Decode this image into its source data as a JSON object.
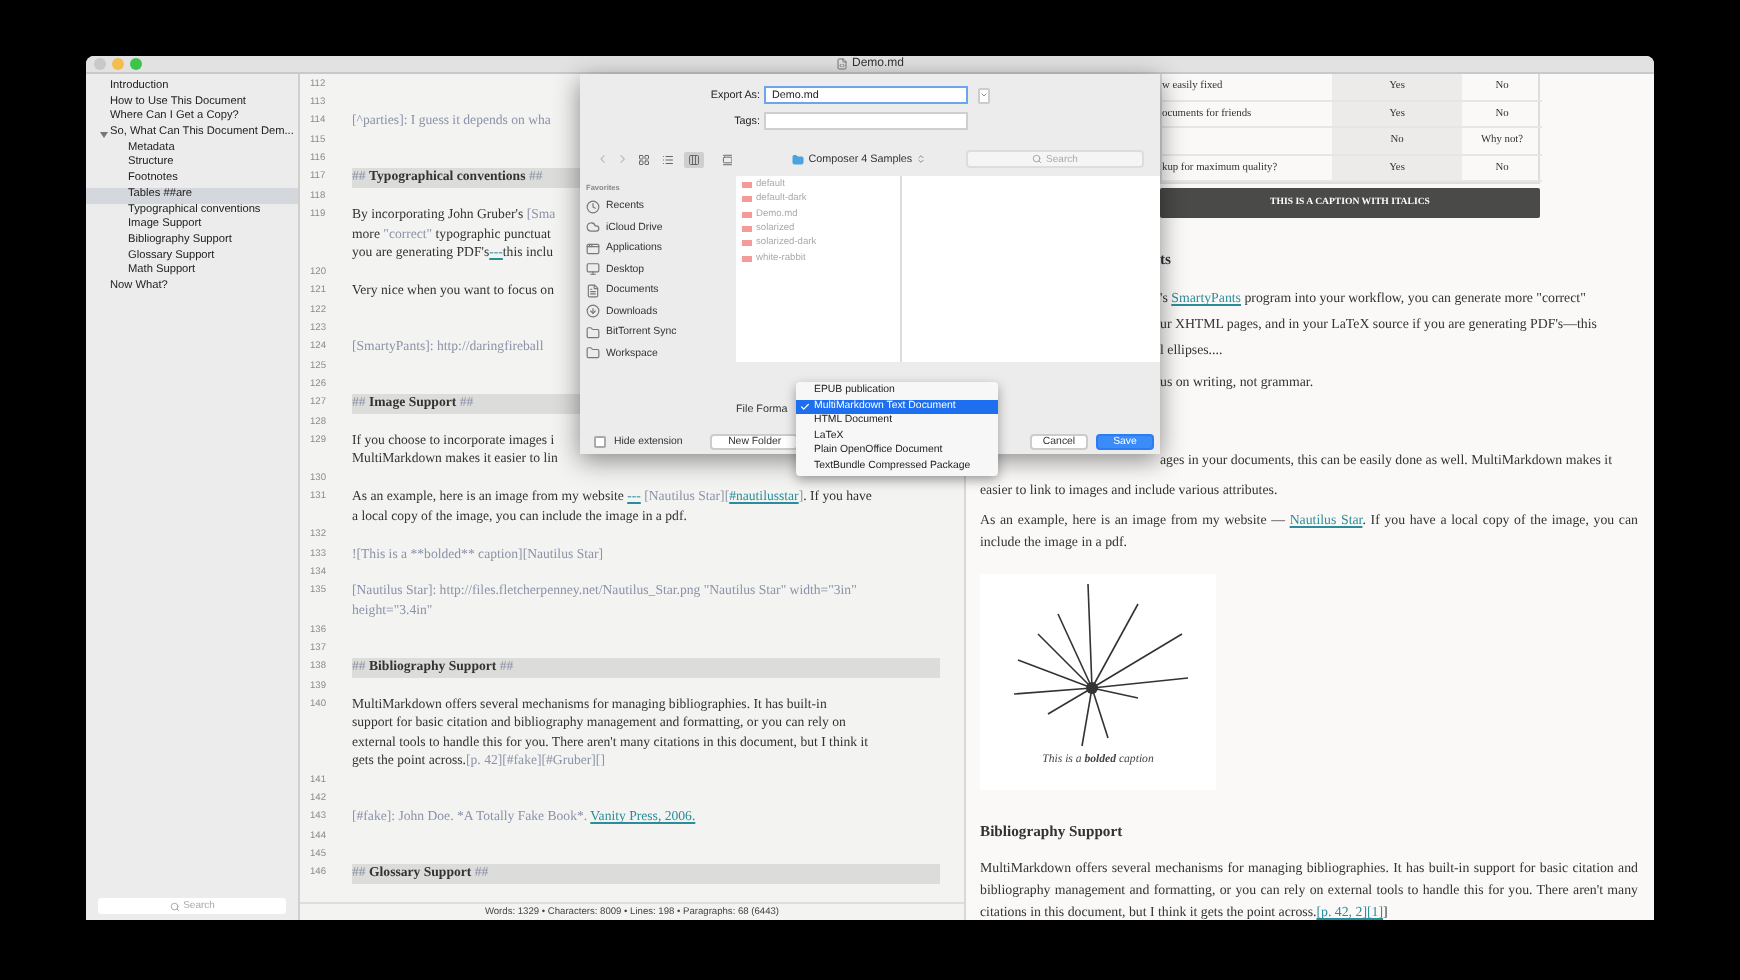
{
  "window": {
    "title": "Demo.md"
  },
  "sidebar": {
    "items": [
      {
        "label": "Introduction",
        "selected": false
      },
      {
        "label": "How to Use This Document",
        "selected": false
      },
      {
        "label": "Where Can I Get a Copy?",
        "selected": false
      },
      {
        "label": "So, What Can This Document Dem...",
        "selected": false,
        "expanded": true,
        "children": [
          {
            "label": "Metadata",
            "selected": false
          },
          {
            "label": "Structure",
            "selected": false
          },
          {
            "label": "Footnotes",
            "selected": false
          },
          {
            "label": "Tables ##are",
            "selected": true
          },
          {
            "label": "Typographical conventions",
            "selected": false
          },
          {
            "label": "Image Support",
            "selected": false
          },
          {
            "label": "Bibliography Support",
            "selected": false
          },
          {
            "label": "Glossary Support",
            "selected": false
          },
          {
            "label": "Math Support",
            "selected": false
          }
        ]
      },
      {
        "label": "Now What?",
        "selected": false
      }
    ],
    "search": {
      "placeholder": "Search"
    }
  },
  "editor": {
    "lines": [
      {
        "number": "112",
        "kind": "blank"
      },
      {
        "number": "113",
        "kind": "blank"
      },
      {
        "number": "114",
        "kind": "text",
        "rows": [
          {
            "segments": [
              {
                "t": "[^parties]: I guess it depends on wha",
                "kind": "muted"
              }
            ]
          }
        ]
      },
      {
        "number": "115",
        "kind": "blank"
      },
      {
        "number": "116",
        "kind": "blank"
      },
      {
        "number": "117",
        "kind": "heading",
        "rows": [
          {
            "segments": [
              {
                "t": "## ",
                "kind": "muted"
              },
              {
                "t": "Typographical conventions",
                "kind": "bold"
              },
              {
                "t": " ##",
                "kind": "muted"
              }
            ]
          }
        ]
      },
      {
        "number": "118",
        "kind": "blank"
      },
      {
        "number": "119",
        "kind": "text",
        "rows": [
          {
            "segments": [
              {
                "t": "By incorporating John Gruber's "
              },
              {
                "t": "[Sma",
                "kind": "muted"
              }
            ]
          },
          {
            "segments": [
              {
                "t": "more "
              },
              {
                "t": "\"correct\"",
                "kind": "muted"
              },
              {
                "t": " typographic punctuat"
              }
            ]
          },
          {
            "segments": [
              {
                "t": "you are generating PDF's"
              },
              {
                "t": "---",
                "kind": "link"
              },
              {
                "t": "this inclu"
              }
            ]
          }
        ]
      },
      {
        "number": "120",
        "kind": "blank"
      },
      {
        "number": "121",
        "kind": "text",
        "rows": [
          {
            "segments": [
              {
                "t": "Very nice when you want to focus on"
              }
            ]
          }
        ]
      },
      {
        "number": "122",
        "kind": "blank"
      },
      {
        "number": "123",
        "kind": "blank"
      },
      {
        "number": "124",
        "kind": "text",
        "rows": [
          {
            "segments": [
              {
                "t": "[SmartyPants]: http://daringfireball",
                "kind": "muted"
              }
            ]
          }
        ]
      },
      {
        "number": "125",
        "kind": "blank"
      },
      {
        "number": "126",
        "kind": "blank"
      },
      {
        "number": "127",
        "kind": "heading",
        "rows": [
          {
            "segments": [
              {
                "t": "## ",
                "kind": "muted"
              },
              {
                "t": "Image Support",
                "kind": "bold"
              },
              {
                "t": " ##",
                "kind": "muted"
              }
            ]
          }
        ]
      },
      {
        "number": "128",
        "kind": "blank"
      },
      {
        "number": "129",
        "kind": "text",
        "rows": [
          {
            "segments": [
              {
                "t": "If you choose to incorporate images i"
              }
            ]
          },
          {
            "segments": [
              {
                "t": "MultiMarkdown makes it easier to lin"
              }
            ]
          }
        ]
      },
      {
        "number": "130",
        "kind": "blank"
      },
      {
        "number": "131",
        "kind": "text",
        "rows": [
          {
            "segments": [
              {
                "t": "As an example, here is an image from my website "
              },
              {
                "t": "---",
                "kind": "link"
              },
              {
                "t": " [Nautilus Star][",
                "kind": "muted"
              },
              {
                "t": "#nautilusstar",
                "kind": "link"
              },
              {
                "t": "]",
                "kind": "muted"
              },
              {
                "t": ". If you have"
              }
            ]
          },
          {
            "segments": [
              {
                "t": "a local copy of the image, you can include the image in a pdf."
              }
            ]
          }
        ]
      },
      {
        "number": "132",
        "kind": "blank"
      },
      {
        "number": "133",
        "kind": "text",
        "rows": [
          {
            "segments": [
              {
                "t": "![This is a **bolded** caption][Nautilus Star]",
                "kind": "muted"
              }
            ]
          }
        ]
      },
      {
        "number": "134",
        "kind": "blank"
      },
      {
        "number": "135",
        "kind": "text",
        "rows": [
          {
            "segments": [
              {
                "t": "[Nautilus Star]: http://files.fletcherpenney.net/Nautilus_Star.png \"Nautilus Star\" width=\"3in\"",
                "kind": "muted"
              }
            ]
          },
          {
            "segments": [
              {
                "t": "height=\"3.4in\"",
                "kind": "muted"
              }
            ]
          }
        ]
      },
      {
        "number": "136",
        "kind": "blank"
      },
      {
        "number": "137",
        "kind": "blank"
      },
      {
        "number": "138",
        "kind": "heading",
        "rows": [
          {
            "segments": [
              {
                "t": "## ",
                "kind": "muted"
              },
              {
                "t": "Bibliography Support",
                "kind": "bold"
              },
              {
                "t": " ##",
                "kind": "muted"
              }
            ]
          }
        ]
      },
      {
        "number": "139",
        "kind": "blank"
      },
      {
        "number": "140",
        "kind": "text",
        "rows": [
          {
            "segments": [
              {
                "t": "MultiMarkdown offers several mechanisms for managing bibliographies.  It has built-in"
              }
            ]
          },
          {
            "segments": [
              {
                "t": "support for basic citation and bibliography management and formatting, or you can rely on"
              }
            ]
          },
          {
            "segments": [
              {
                "t": "external tools to handle this for you. There aren't many citations in this document, but I think it"
              }
            ]
          },
          {
            "segments": [
              {
                "t": "gets the point across."
              },
              {
                "t": "[p. 42][#fake][#Gruber][]",
                "kind": "muted"
              }
            ]
          }
        ]
      },
      {
        "number": "141",
        "kind": "blank"
      },
      {
        "number": "142",
        "kind": "blank"
      },
      {
        "number": "143",
        "kind": "text",
        "rows": [
          {
            "segments": [
              {
                "t": "[#fake]: John Doe. *A Totally Fake Book*. ",
                "kind": "muted"
              },
              {
                "t": "Vanity Press, 2006.",
                "kind": "link"
              }
            ]
          }
        ]
      },
      {
        "number": "144",
        "kind": "blank"
      },
      {
        "number": "145",
        "kind": "blank"
      },
      {
        "number": "146",
        "kind": "heading",
        "rows": [
          {
            "segments": [
              {
                "t": "## ",
                "kind": "muted"
              },
              {
                "t": "Glossary Support",
                "kind": "bold"
              },
              {
                "t": " ##",
                "kind": "muted"
              }
            ]
          }
        ]
      }
    ]
  },
  "status_bar": "Words: 1329 • Characters: 8009 • Lines: 198 • Paragraphs: 68 (6443)",
  "preview": {
    "table": {
      "rows": [
        [
          "w easily fixed",
          "Yes",
          "No"
        ],
        [
          "ocuments for friends",
          "Yes",
          "No"
        ],
        [
          "",
          "No",
          "Why not?"
        ],
        [
          "kup for maximum quality?",
          "Yes",
          "No"
        ]
      ]
    },
    "caption": "THIS IS A CAPTION WITH ITALICS",
    "partial_blocks": [
      {
        "kind": "heading",
        "segments": [
          {
            "t": "ts"
          }
        ]
      },
      {
        "kind": "line",
        "segments": [
          {
            "t": "'s "
          },
          {
            "t": "SmartyPants",
            "kind": "link"
          },
          {
            "t": " program into your workflow, you can generate more \"correct\""
          }
        ]
      },
      {
        "kind": "line",
        "segments": [
          {
            "t": "ur XHTML pages, and in your LaTeX source if you are generating PDF's—this"
          }
        ]
      },
      {
        "kind": "line",
        "segments": [
          {
            "t": "l ellipses...."
          }
        ]
      },
      {
        "kind": "paragraph",
        "segments": [
          {
            "t": "us on writing, not grammar."
          }
        ]
      },
      {
        "kind": "gap"
      },
      {
        "kind": "paragraph",
        "segments": [
          {
            "t": "ages in your documents, this can be easily done as well. MultiMarkdown makes it"
          }
        ]
      }
    ],
    "blocks": [
      {
        "kind": "paragraph",
        "segments": [
          {
            "t": "easier to link to images and include various attributes."
          }
        ]
      },
      {
        "kind": "paragraph",
        "segments": [
          {
            "t": "As an example, here is an image from my website — "
          },
          {
            "t": "Nautilus Star",
            "kind": "link"
          },
          {
            "t": ". If you have a local copy of the image, you can include the image in a pdf."
          }
        ]
      },
      {
        "kind": "figure",
        "caption": "This is a **bolded** caption"
      },
      {
        "kind": "heading",
        "segments": [
          {
            "t": "Bibliography Support"
          }
        ]
      },
      {
        "kind": "paragraph",
        "segments": [
          {
            "t": "MultiMarkdown offers several mechanisms for managing bibliographies. It has built-in support for basic citation and bibliography management and formatting, or you can rely on external tools to handle this for you. There aren't many citations in this document, but I think it gets the point across."
          },
          {
            "t": "[p. 42, 2][1]",
            "kind": "link"
          },
          {
            "t": "]"
          }
        ]
      }
    ]
  },
  "dialog": {
    "export_as": {
      "label": "Export As:",
      "value": "Demo.md"
    },
    "tags": {
      "label": "Tags:"
    },
    "views": [
      {
        "selected": false
      },
      {
        "selected": false
      },
      {
        "selected": true
      }
    ],
    "location": "Composer 4 Samples",
    "search": {
      "placeholder": "Search"
    },
    "favorites": {
      "title": "Favorites",
      "items": [
        "Recents",
        "iCloud Drive",
        "Applications",
        "Desktop",
        "Documents",
        "Downloads",
        "BitTorrent Sync",
        "Workspace"
      ]
    },
    "files": [
      {
        "name": "default",
        "disabled": true
      },
      {
        "name": "default-dark",
        "disabled": true
      },
      {
        "name": "Demo.md",
        "disabled": true
      },
      {
        "name": "solarized",
        "disabled": true
      },
      {
        "name": "solarized-dark",
        "disabled": true
      },
      {
        "name": "white-rabbit",
        "disabled": true
      }
    ],
    "format_label": "File Forma",
    "formats": [
      {
        "label": "EPUB publication",
        "selected": false
      },
      {
        "label": "MultiMarkdown Text Document",
        "selected": true
      },
      {
        "label": "HTML Document",
        "selected": false
      },
      {
        "label": "LaTeX",
        "selected": false
      },
      {
        "label": "Plain OpenOffice Document",
        "selected": false
      },
      {
        "label": "TextBundle Compressed Package",
        "selected": false
      }
    ],
    "hide_extension": {
      "label": "Hide extension",
      "checked": false
    },
    "buttons": {
      "new_folder": "New Folder",
      "cancel": "Cancel",
      "save": "Save"
    }
  }
}
